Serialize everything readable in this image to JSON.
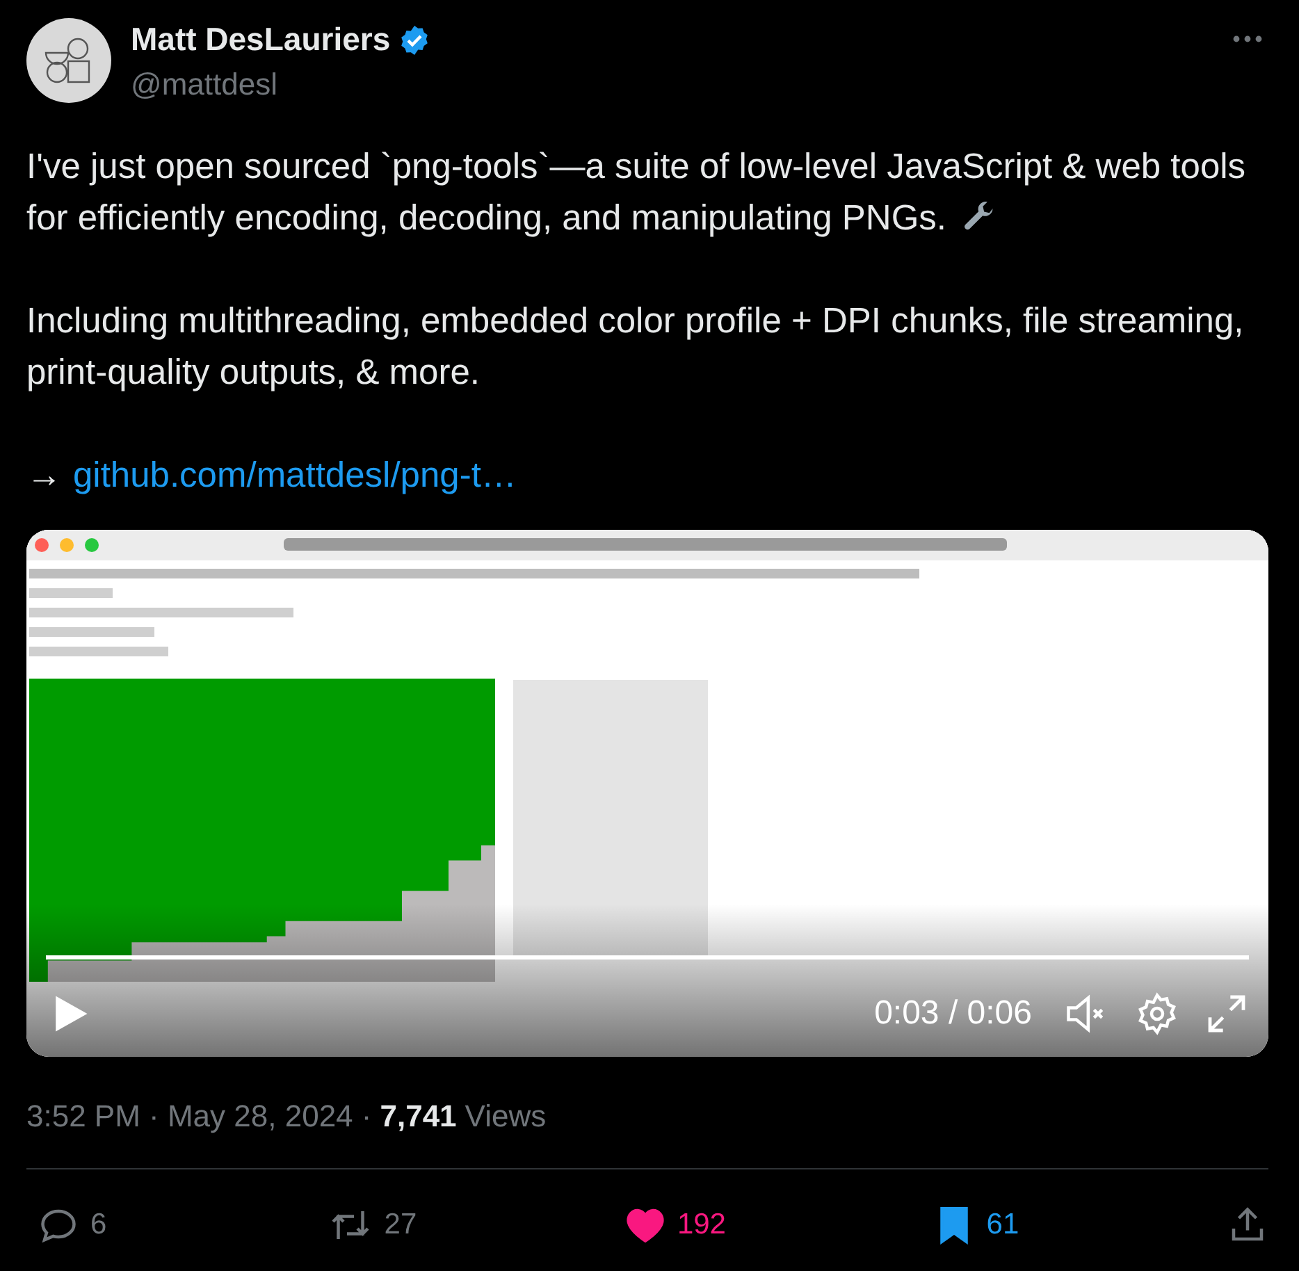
{
  "author": {
    "name": "Matt DesLauriers",
    "verified": true,
    "handle": "@mattdesl"
  },
  "paragraphs": [
    {
      "kind": "text_with_wrench",
      "text": "I've just open sourced `png-tools`—a suite of low-level JavaScript & web tools for efficiently encoding, decoding, and manipulating PNGs."
    },
    {
      "kind": "text",
      "text": "Including multithreading, embedded color profile + DPI chunks, file streaming, print-quality outputs, & more."
    },
    {
      "kind": "link",
      "prefix": "→",
      "text": "github.com/mattdesl/png-t…"
    }
  ],
  "video": {
    "kind": "picture",
    "playing": false,
    "muted": true,
    "time": "0:03 / 0:06",
    "level": 1
  },
  "meta": {
    "time": "3:52 PM · May 28, 2024 ·",
    "views_count": "7,741",
    "views_label": "Views"
  },
  "actions": [
    {
      "kind": "reply",
      "count": "6"
    },
    {
      "kind": "repost",
      "count": "27"
    },
    {
      "kind": "like",
      "count": "192",
      "on": true
    },
    {
      "kind": "bookmark",
      "count": "61",
      "on": true
    },
    {
      "kind": "share"
    }
  ]
}
